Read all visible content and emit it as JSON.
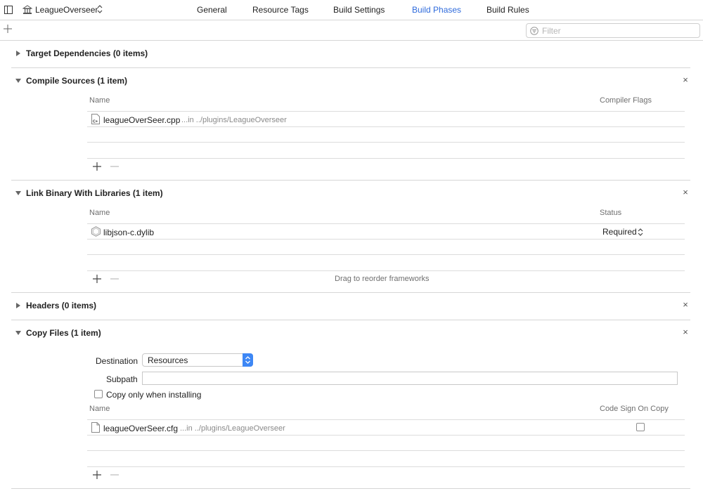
{
  "header": {
    "target_name": "LeagueOverseer",
    "tabs": [
      {
        "label": "General"
      },
      {
        "label": "Resource Tags"
      },
      {
        "label": "Build Settings"
      },
      {
        "label": "Build Phases"
      },
      {
        "label": "Build Rules"
      }
    ],
    "active_tab": "Build Phases",
    "accent_color": "#2f6bdc"
  },
  "filter": {
    "placeholder": "Filter"
  },
  "phases": {
    "target_dependencies": {
      "title": "Target Dependencies (0 items)",
      "expanded": false
    },
    "compile_sources": {
      "title": "Compile Sources (1 item)",
      "expanded": true,
      "columns": [
        "Name",
        "Compiler Flags"
      ],
      "rows": [
        {
          "name": "leagueOverSeer.cpp",
          "path": "...in ../plugins/LeagueOverseer",
          "icon": "cpp-file-icon"
        }
      ]
    },
    "link_binary": {
      "title": "Link Binary With Libraries (1 item)",
      "expanded": true,
      "columns": [
        "Name",
        "Status"
      ],
      "rows": [
        {
          "name": "libjson-c.dylib",
          "status": "Required",
          "icon": "library-icon"
        }
      ],
      "drag_hint": "Drag to reorder frameworks"
    },
    "headers": {
      "title": "Headers (0 items)",
      "expanded": false
    },
    "copy_files": {
      "title": "Copy Files (1 item)",
      "expanded": true,
      "destination_label": "Destination",
      "destination_value": "Resources",
      "subpath_label": "Subpath",
      "subpath_value": "",
      "copy_only_label": "Copy only when installing",
      "copy_only_checked": false,
      "columns": [
        "Name",
        "Code Sign On Copy"
      ],
      "rows": [
        {
          "name": "leagueOverSeer.cfg",
          "path": "...in ../plugins/LeagueOverseer",
          "code_sign": false,
          "icon": "document-icon"
        }
      ]
    }
  }
}
